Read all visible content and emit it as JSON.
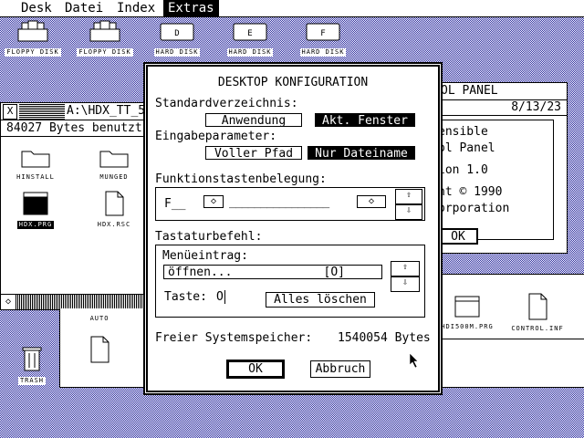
{
  "menubar": {
    "items": [
      "Desk",
      "Datei",
      "Index",
      "Extras"
    ],
    "active": "Extras"
  },
  "desktop_icons": [
    {
      "label": "FLOPPY DISK",
      "icon": "floppy-disk-icon"
    },
    {
      "label": "FLOPPY DISK",
      "icon": "floppy-disk-icon"
    },
    {
      "label": "HARD DISK",
      "icon": "hard-disk-icon",
      "letter": "D"
    },
    {
      "label": "HARD DISK",
      "icon": "hard-disk-icon",
      "letter": "E"
    },
    {
      "label": "HARD DISK",
      "icon": "hard-disk-icon",
      "letter": "F"
    }
  ],
  "trash": {
    "label": "TRASH"
  },
  "window_left": {
    "close_glyph": "X",
    "title": "A:\\HDX_TT_5",
    "info": "84027 Bytes benutzt",
    "files": [
      {
        "label": "HINSTALL",
        "icon": "folder-icon"
      },
      {
        "label": "MUNGED",
        "icon": "folder-icon"
      },
      {
        "label": "HDX.PRG",
        "icon": "program-icon",
        "selected": true
      },
      {
        "label": "HDX.RSC",
        "icon": "document-icon"
      }
    ],
    "scroll_left_glyph": "◇"
  },
  "window_bottom": {
    "files": [
      {
        "label": "AUTO",
        "icon": "folder-icon"
      },
      {
        "label": "",
        "icon": "document-icon"
      },
      {
        "label": "HDI500M.PRG",
        "icon": "program-icon"
      },
      {
        "label": "CONTROL.INF",
        "icon": "document-icon"
      }
    ]
  },
  "control_panel": {
    "title": "OL PANEL",
    "date": "8/13/23",
    "lines": [
      "ensible",
      "ol Panel",
      "ion 1.0",
      "ht © 1990",
      "orporation"
    ],
    "ok_label": "OK"
  },
  "dialog": {
    "title": "DESKTOP KONFIGURATION",
    "standard_dir_label": "Standardverzeichnis:",
    "standard_dir_options": [
      "Anwendung",
      "Akt. Fenster"
    ],
    "standard_dir_selected": "Akt. Fenster",
    "input_param_label": "Eingabeparameter:",
    "input_param_options": [
      "Voller Pfad",
      "Nur Dateiname"
    ],
    "input_param_selected": "Nur Dateiname",
    "fkey_label": "Funktionstastenbelegung:",
    "fkey_prefix": "F__",
    "fkey_field": "________________",
    "shortcut_label": "Tastaturbefehl:",
    "menu_entry_label": "Menüeintrag:",
    "menu_entry_value": "öffnen...",
    "menu_entry_key": "[O]",
    "key_label": "Taste:",
    "key_value": "O",
    "clear_all_label": "Alles löschen",
    "free_mem_label": "Freier Systemspeicher:",
    "free_mem_value": "1540054 Bytes",
    "ok_label": "OK",
    "cancel_label": "Abbruch",
    "arrow_up": "⇧",
    "arrow_down": "⇩",
    "arrow_left": "◇",
    "arrow_right": "◇"
  }
}
